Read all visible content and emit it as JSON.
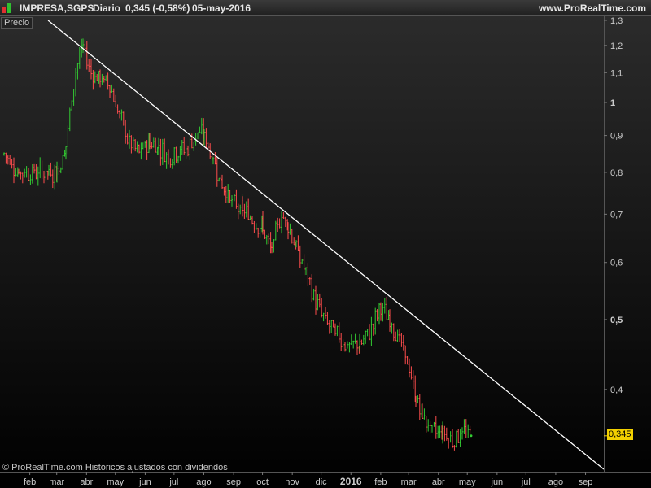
{
  "header": {
    "ticker": "IMPRESA,SGPS",
    "period": "Diario",
    "price_change": "0,345 (-0,58%)",
    "date": "05-may-2016",
    "site": "www.ProRealTime.com",
    "logo_colors": [
      "#e03030",
      "#30c030"
    ]
  },
  "panel_label": "Precio",
  "copyright": "© ProRealTime.com  Históricos ajustados con dividendos",
  "last_price_label": "0,345",
  "colors": {
    "up": "#33cc33",
    "down": "#ff4d4d",
    "trendline": "#ffffff",
    "last_price_bg": "#f2d000",
    "axis_text": "#cccccc"
  },
  "chart_data": {
    "type": "line",
    "style": "ohlc-bars",
    "scale": "log",
    "ylim": [
      0.31,
      1.3
    ],
    "y_ticks": [
      {
        "value": 1.3,
        "label": "1,3"
      },
      {
        "value": 1.2,
        "label": "1,2"
      },
      {
        "value": 1.1,
        "label": "1,1"
      },
      {
        "value": 1.0,
        "label": "1",
        "bold": true
      },
      {
        "value": 0.9,
        "label": "0,9"
      },
      {
        "value": 0.8,
        "label": "0,8"
      },
      {
        "value": 0.7,
        "label": "0,7"
      },
      {
        "value": 0.6,
        "label": "0,6"
      },
      {
        "value": 0.5,
        "label": "0,5",
        "bold": true
      },
      {
        "value": 0.4,
        "label": "0,4"
      }
    ],
    "x_ticks": [
      {
        "date": "2015-02-01",
        "label": "feb"
      },
      {
        "date": "2015-03-01",
        "label": "mar"
      },
      {
        "date": "2015-04-01",
        "label": "abr"
      },
      {
        "date": "2015-05-01",
        "label": "may"
      },
      {
        "date": "2015-06-01",
        "label": "jun"
      },
      {
        "date": "2015-07-01",
        "label": "jul"
      },
      {
        "date": "2015-08-01",
        "label": "ago"
      },
      {
        "date": "2015-09-01",
        "label": "sep"
      },
      {
        "date": "2015-10-01",
        "label": "oct"
      },
      {
        "date": "2015-11-01",
        "label": "nov"
      },
      {
        "date": "2015-12-01",
        "label": "dic"
      },
      {
        "date": "2016-01-01",
        "label": "2016",
        "bold": true
      },
      {
        "date": "2016-02-01",
        "label": "feb"
      },
      {
        "date": "2016-03-01",
        "label": "mar"
      },
      {
        "date": "2016-04-01",
        "label": "abr"
      },
      {
        "date": "2016-05-01",
        "label": "may"
      },
      {
        "date": "2016-06-01",
        "label": "jun"
      },
      {
        "date": "2016-07-01",
        "label": "jul"
      },
      {
        "date": "2016-08-01",
        "label": "ago"
      },
      {
        "date": "2016-09-01",
        "label": "sep"
      }
    ],
    "xlim": [
      "2015-01-01",
      "2016-09-20"
    ],
    "series": [
      {
        "x": [
          "2015-01-05",
          "2015-01-20",
          "2015-02-05",
          "2015-02-20",
          "2015-03-01",
          "2015-03-10",
          "2015-03-20",
          "2015-03-28",
          "2015-04-05",
          "2015-04-15",
          "2015-04-25",
          "2015-05-05",
          "2015-05-15",
          "2015-05-25",
          "2015-06-05",
          "2015-06-15",
          "2015-06-25",
          "2015-07-05",
          "2015-07-15",
          "2015-07-25",
          "2015-08-01",
          "2015-08-10",
          "2015-08-20",
          "2015-09-01",
          "2015-09-10",
          "2015-09-20",
          "2015-10-01",
          "2015-10-10",
          "2015-10-20",
          "2015-10-27",
          "2015-11-05",
          "2015-11-15",
          "2015-11-25",
          "2015-12-05",
          "2015-12-15",
          "2015-12-28",
          "2016-01-10",
          "2016-01-20",
          "2016-02-01",
          "2016-02-10",
          "2016-02-20",
          "2016-03-01",
          "2016-03-08",
          "2016-03-15",
          "2016-03-25",
          "2016-04-05",
          "2016-04-15",
          "2016-04-25",
          "2016-05-05"
        ],
        "values": [
          0.85,
          0.8,
          0.8,
          0.8,
          0.8,
          0.86,
          1.1,
          1.2,
          1.1,
          1.08,
          1.06,
          0.96,
          0.88,
          0.85,
          0.88,
          0.87,
          0.84,
          0.86,
          0.86,
          0.91,
          0.9,
          0.84,
          0.77,
          0.72,
          0.71,
          0.69,
          0.67,
          0.62,
          0.7,
          0.68,
          0.63,
          0.58,
          0.53,
          0.5,
          0.48,
          0.46,
          0.46,
          0.48,
          0.52,
          0.5,
          0.47,
          0.43,
          0.39,
          0.37,
          0.35,
          0.35,
          0.34,
          0.35,
          0.345
        ]
      }
    ],
    "trendline": {
      "start": {
        "date": "2015-02-20",
        "value": 1.3
      },
      "end": {
        "date": "2016-09-20",
        "value": 0.31
      }
    }
  }
}
